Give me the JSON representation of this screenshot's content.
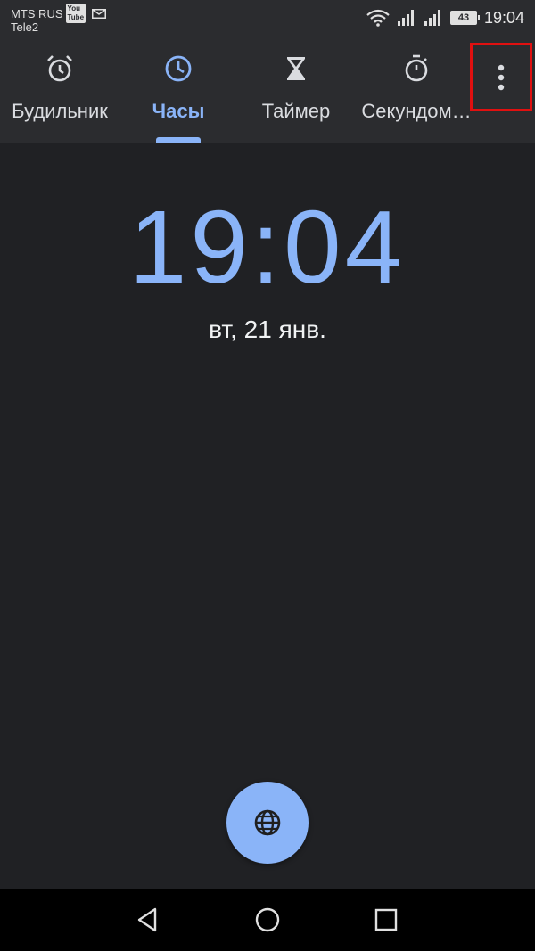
{
  "status_bar": {
    "carrier_primary": "MTS RUS",
    "badge": "YouTube",
    "carrier_secondary": "Tele2",
    "battery_level": "43",
    "time": "19:04",
    "icons": [
      "message-icon",
      "wifi-icon",
      "signal-icon",
      "signal-icon",
      "battery-icon"
    ]
  },
  "tabs": [
    {
      "label": "Будильник",
      "icon": "alarm-icon",
      "active": false
    },
    {
      "label": "Часы",
      "icon": "clock-icon",
      "active": true
    },
    {
      "label": "Таймер",
      "icon": "hourglass-icon",
      "active": false
    },
    {
      "label": "Секундом…",
      "icon": "stopwatch-icon",
      "active": false
    }
  ],
  "more_menu": {
    "icon": "more-vert-icon",
    "highlight_color": "#e01010"
  },
  "main": {
    "time": "19:04",
    "date": "вт, 21 янв."
  },
  "fab": {
    "icon": "globe-icon"
  },
  "nav": {
    "icons": [
      "back-icon",
      "home-icon",
      "recents-icon"
    ]
  },
  "colors": {
    "accent": "#8ab4f8",
    "background": "#202124",
    "bar": "#2b2c2f"
  }
}
